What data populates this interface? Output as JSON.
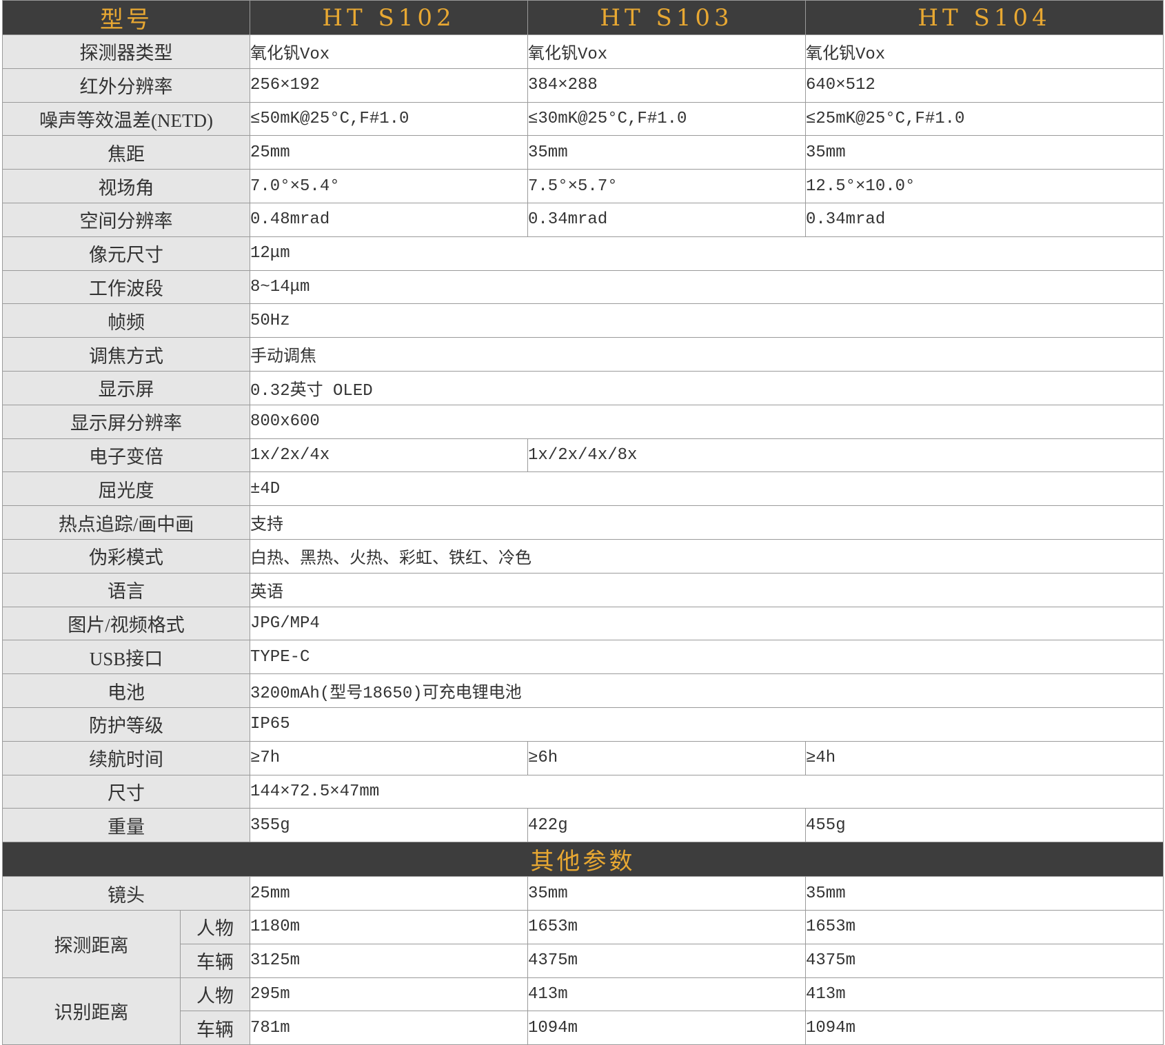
{
  "header": {
    "label": "型号",
    "models": [
      "HT S102",
      "HT S103",
      "HT S104"
    ]
  },
  "specs": {
    "detector_type": {
      "label": "探测器类型",
      "values": [
        "氧化钒Vox",
        "氧化钒Vox",
        "氧化钒Vox"
      ]
    },
    "ir_resolution": {
      "label": "红外分辨率",
      "values": [
        "256×192",
        "384×288",
        "640×512"
      ]
    },
    "netd": {
      "label": "噪声等效温差(NETD)",
      "values": [
        "≤50mK@25°C,F#1.0",
        "≤30mK@25°C,F#1.0",
        "≤25mK@25°C,F#1.0"
      ]
    },
    "focal_length": {
      "label": "焦距",
      "values": [
        "25mm",
        "35mm",
        "35mm"
      ]
    },
    "fov": {
      "label": "视场角",
      "values": [
        "7.0°×5.4°",
        "7.5°×5.7°",
        "12.5°×10.0°"
      ]
    },
    "spatial_resolution": {
      "label": "空间分辨率",
      "values": [
        "0.48mrad",
        "0.34mrad",
        "0.34mrad"
      ]
    },
    "pixel_size": {
      "label": "像元尺寸",
      "value": "12μm"
    },
    "band": {
      "label": "工作波段",
      "value": "8~14μm"
    },
    "frame_rate": {
      "label": "帧频",
      "value": "50Hz"
    },
    "focus": {
      "label": "调焦方式",
      "value": "手动调焦"
    },
    "display": {
      "label": "显示屏",
      "value": "0.32英寸 OLED"
    },
    "display_resolution": {
      "label": "显示屏分辨率",
      "value": "800x600"
    },
    "zoom": {
      "label": "电子变倍",
      "values": [
        "1x/2x/4x",
        "1x/2x/4x/8x"
      ]
    },
    "diopter": {
      "label": "屈光度",
      "value": "±4D"
    },
    "hotspot": {
      "label": "热点追踪/画中画",
      "value": "支持"
    },
    "palettes": {
      "label": "伪彩模式",
      "value": "白热、黑热、火热、彩虹、铁红、冷色"
    },
    "language": {
      "label": "语言",
      "value": "英语"
    },
    "formats": {
      "label": "图片/视频格式",
      "value": "JPG/MP4"
    },
    "usb": {
      "label": "USB接口",
      "value": "TYPE-C"
    },
    "battery": {
      "label": "电池",
      "value": "3200mAh(型号18650)可充电锂电池"
    },
    "protection": {
      "label": "防护等级",
      "value": "IP65"
    },
    "runtime": {
      "label": "续航时间",
      "values": [
        "≥7h",
        "≥6h",
        "≥4h"
      ]
    },
    "size": {
      "label": "尺寸",
      "value": "144×72.5×47mm"
    },
    "weight": {
      "label": "重量",
      "values": [
        "355g",
        "422g",
        "455g"
      ]
    }
  },
  "other": {
    "title": "其他参数",
    "lens": {
      "label": "镜头",
      "values": [
        "25mm",
        "35mm",
        "35mm"
      ]
    },
    "detection": {
      "label": "探测距离",
      "person": {
        "label": "人物",
        "values": [
          "1180m",
          "1653m",
          "1653m"
        ]
      },
      "vehicle": {
        "label": "车辆",
        "values": [
          "3125m",
          "4375m",
          "4375m"
        ]
      }
    },
    "recognition": {
      "label": "识别距离",
      "person": {
        "label": "人物",
        "values": [
          "295m",
          "413m",
          "413m"
        ]
      },
      "vehicle": {
        "label": "车辆",
        "values": [
          "781m",
          "1094m",
          "1094m"
        ]
      }
    }
  }
}
